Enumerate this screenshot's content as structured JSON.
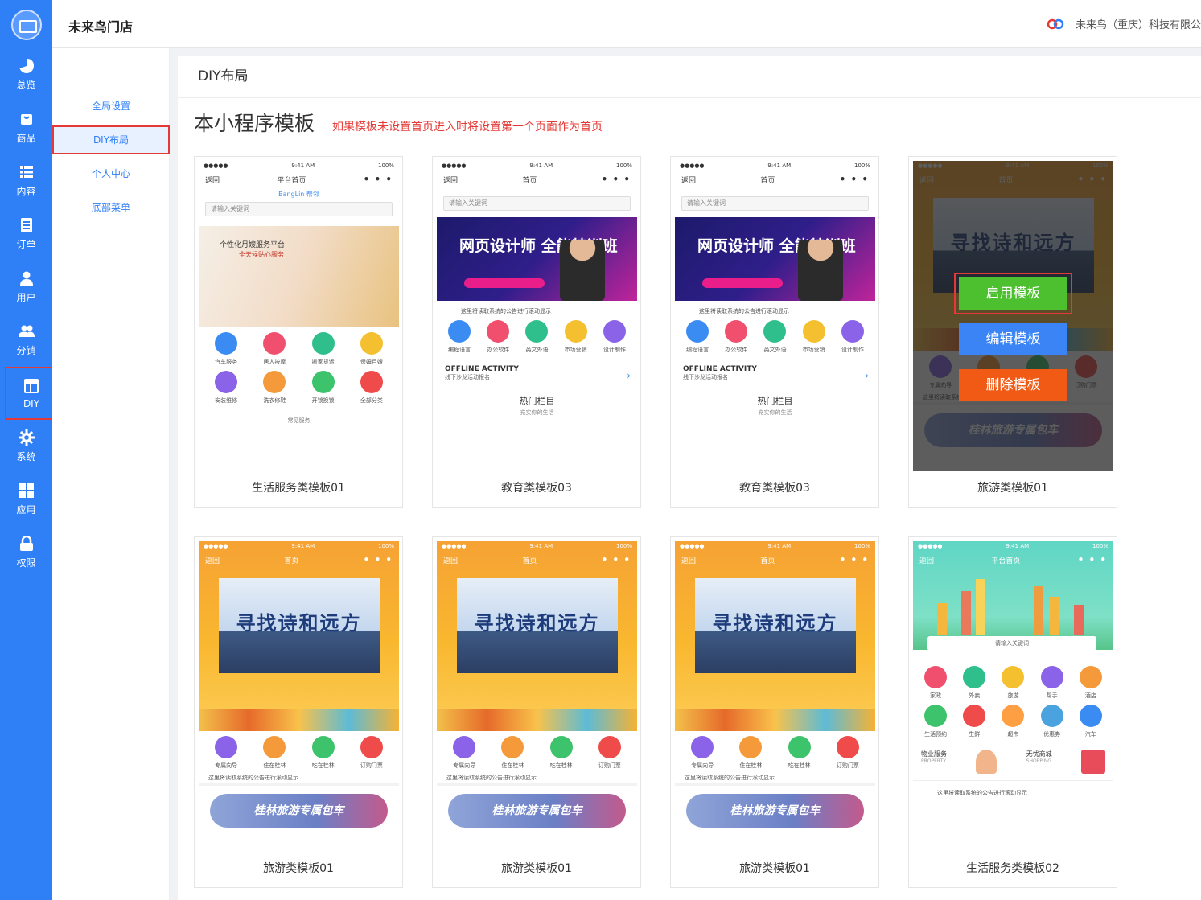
{
  "sidebar": {
    "items": [
      {
        "label": "总览",
        "icon": "pie-chart-icon"
      },
      {
        "label": "商品",
        "icon": "bag-icon"
      },
      {
        "label": "内容",
        "icon": "list-icon"
      },
      {
        "label": "订单",
        "icon": "document-icon"
      },
      {
        "label": "用户",
        "icon": "user-icon"
      },
      {
        "label": "分销",
        "icon": "users-icon"
      },
      {
        "label": "DIY",
        "icon": "layout-icon"
      },
      {
        "label": "系统",
        "icon": "gear-icon"
      },
      {
        "label": "应用",
        "icon": "grid-icon"
      },
      {
        "label": "权限",
        "icon": "lock-icon"
      }
    ],
    "active_index": 6
  },
  "header": {
    "store_name": "未来鸟门店",
    "company": "未来鸟（重庆）科技有限公"
  },
  "submenu": {
    "items": [
      "全局设置",
      "DIY布局",
      "个人中心",
      "底部菜单"
    ],
    "active_index": 1
  },
  "main": {
    "breadcrumb": "DIY布局",
    "section_title": "本小程序模板",
    "tip": "如果模板未设置首页进入时将设置第一个页面作为首页",
    "actions": {
      "enable": "启用模板",
      "edit": "编辑模板",
      "delete": "删除模板"
    },
    "templates": [
      {
        "name": "生活服务类模板01",
        "type": "life1",
        "nav_title": "平台首页",
        "search": "请输入关键词",
        "brand": "BangLin 帮邻",
        "slogan1": "个性化月嫂服务平台",
        "slogan2": "全天候贴心服务",
        "icons": [
          "汽车服务",
          "居人按摩",
          "搬家货运",
          "保姆月嫂",
          "安装维修",
          "洗衣修鞋",
          "开锁换锁",
          "全部分类"
        ],
        "footer": "常见服务"
      },
      {
        "name": "教育类模板03",
        "type": "edu",
        "nav_title": "首页",
        "search": "请输入关键词",
        "banner": "网页设计师 全能特训班",
        "notice": "这里将读取系统的公告进行滚动显示",
        "icons": [
          "编程语言",
          "办公软件",
          "英文外语",
          "市场营销",
          "设计制作"
        ],
        "activity": "OFFLINE ACTIVITY",
        "activity_sub": "线下沙龙活动报名",
        "hot": "热门栏目",
        "hot_sub": "充实你的生活"
      },
      {
        "name": "教育类模板03",
        "type": "edu",
        "nav_title": "首页",
        "search": "请输入关键词",
        "banner": "网页设计师 全能特训班",
        "notice": "这里将读取系统的公告进行滚动显示",
        "icons": [
          "编程语言",
          "办公软件",
          "英文外语",
          "市场营销",
          "设计制作"
        ],
        "activity": "OFFLINE ACTIVITY",
        "activity_sub": "线下沙龙活动报名",
        "hot": "热门栏目",
        "hot_sub": "充实你的生活"
      },
      {
        "name": "旅游类模板01",
        "type": "travel",
        "hover": true,
        "nav_title": "首页",
        "banner": "寻找诗和远方",
        "notice": "这里将读取系统的公告进行滚动显示",
        "icons": [
          "专属向导",
          "住在桂林",
          "吃在桂林",
          "订购门票"
        ],
        "promo": "桂林旅游专属包车"
      },
      {
        "name": "旅游类模板01",
        "type": "travel",
        "nav_title": "首页",
        "banner": "寻找诗和远方",
        "notice": "这里将读取系统的公告进行滚动显示",
        "icons": [
          "专属向导",
          "住在桂林",
          "吃在桂林",
          "订购门票"
        ],
        "promo": "桂林旅游专属包车"
      },
      {
        "name": "旅游类模板01",
        "type": "travel",
        "nav_title": "首页",
        "banner": "寻找诗和远方",
        "notice": "这里将读取系统的公告进行滚动显示",
        "icons": [
          "专属向导",
          "住在桂林",
          "吃在桂林",
          "订购门票"
        ],
        "promo": "桂林旅游专属包车"
      },
      {
        "name": "旅游类模板01",
        "type": "travel",
        "nav_title": "首页",
        "banner": "寻找诗和远方",
        "notice": "这里将读取系统的公告进行滚动显示",
        "icons": [
          "专属向导",
          "住在桂林",
          "吃在桂林",
          "订购门票"
        ],
        "promo": "桂林旅游专属包车"
      },
      {
        "name": "生活服务类模板02",
        "type": "life2",
        "nav_title": "平台首页",
        "search": "请输入关键词",
        "notice": "这里将读取系统的公告进行滚动显示",
        "icons": [
          "家政",
          "外卖",
          "旅游",
          "帮手",
          "酒店",
          "生活预约",
          "生鲜",
          "超市",
          "优惠券",
          "汽车"
        ],
        "tile1": "物业服务",
        "tile1_en": "PROPERTY",
        "tile2": "无忧商城",
        "tile2_en": "SHOPPING"
      }
    ]
  },
  "status_bar": {
    "time": "9:41 AM",
    "battery": "100%",
    "back": "返回"
  },
  "colors": {
    "rail": "#2f7ff7",
    "accent_red": "#e53935",
    "btn_green": "#4cc02f",
    "btn_blue": "#3a84f6",
    "btn_orange": "#f05a15"
  }
}
